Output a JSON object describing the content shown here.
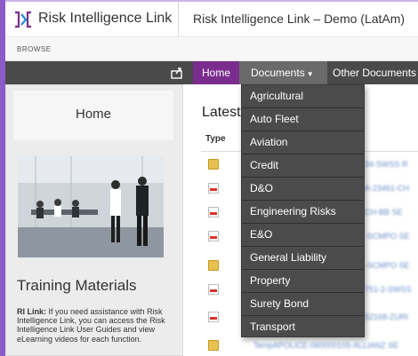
{
  "header": {
    "app_title": "Risk Intelligence Link",
    "site_title": "Risk Intelligence Link – Demo (LatAm)",
    "brand_color": "#7b2d8e"
  },
  "ribbon": {
    "browse_label": "BROWSE"
  },
  "nav": {
    "home": "Home",
    "documents": "Documents",
    "other_documents": "Other Documents"
  },
  "documents_menu": {
    "items": [
      "Agricultural",
      "Auto Fleet",
      "Aviation",
      "Credit",
      "D&O",
      "Engineering Risks",
      "E&O",
      "General Liability",
      "Property",
      "Surety Bond",
      "Transport"
    ]
  },
  "left_panel": {
    "home_label": "Home",
    "training_title": "Training Materials",
    "training_lead": "RI Link:",
    "training_text": " If you need assistance with Risk Intelligence Link, you can access the Risk Intelligence Link User Guides and view eLearning videos for each function."
  },
  "main": {
    "title": "Latest",
    "type_header": "Type",
    "rows": [
      {
        "icon": "folder-icon",
        "text": "34-SWSS R"
      },
      {
        "icon": "pdf-icon",
        "text": "A-23461-CH"
      },
      {
        "icon": "pdf-icon",
        "text": "CH-BB SE"
      },
      {
        "icon": "pdf-icon",
        "text": "-SCMPO SE"
      },
      {
        "icon": "folder-icon",
        "text": "-SCMPO SE"
      },
      {
        "icon": "pdf-icon",
        "text": "751-2-SWSS"
      },
      {
        "icon": "pdf-icon",
        "text": "52168-ZURI"
      },
      {
        "icon": "folder-icon",
        "text": "TempAPOLICE-060000105-ALLIANZ SE"
      }
    ]
  }
}
